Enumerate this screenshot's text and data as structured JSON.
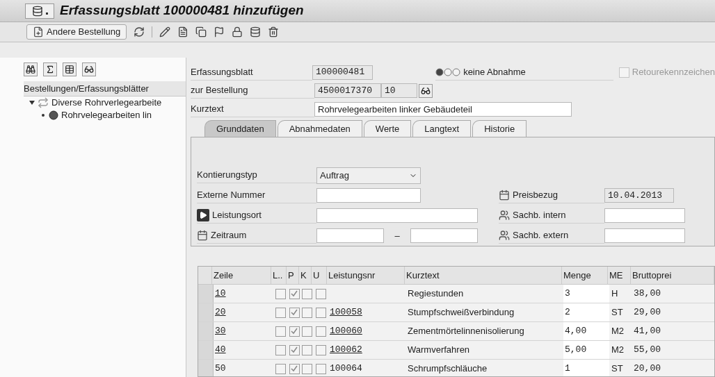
{
  "window": {
    "title": "Erfassungsblatt 100000481 hinzufügen"
  },
  "toolbar": {
    "button": "Andere Bestellung"
  },
  "sidebar": {
    "header": "Bestellungen/Erfassungsblätter",
    "tree": [
      {
        "label": "Diverse Rohrverlegearbeite",
        "expanded": true,
        "children": [
          {
            "label": "Rohrvelegearbeiten lin"
          }
        ]
      }
    ]
  },
  "header": {
    "erfassungsblatt": {
      "label": "Erfassungsblatt",
      "value": "100000481"
    },
    "bestellung": {
      "label": "zur Bestellung",
      "value": "4500017370",
      "item": "10"
    },
    "kurztext": {
      "label": "Kurztext",
      "value": "Rohrvelegearbeiten linker Gebäudeteil"
    },
    "status": {
      "lights": [
        true,
        false,
        false
      ],
      "label": "keine Abnahme"
    },
    "retoure": {
      "label": "Retourekennzeichen",
      "checked": false,
      "disabled": true
    }
  },
  "tabs": [
    {
      "label": "Grunddaten",
      "selected": true
    },
    {
      "label": "Abnahmedaten",
      "selected": false
    },
    {
      "label": "Werte",
      "selected": false
    },
    {
      "label": "Langtext",
      "selected": false
    },
    {
      "label": "Historie",
      "selected": false
    }
  ],
  "form": {
    "kontierungstyp": {
      "label": "Kontierungstyp",
      "value": "Auftrag"
    },
    "externe_nummer": {
      "label": "Externe Nummer"
    },
    "leistungsort": {
      "label": "Leistungsort"
    },
    "zeitraum": {
      "label": "Zeitraum",
      "separator": "–"
    },
    "preisbezug": {
      "label": "Preisbezug",
      "value": "10.04.2013"
    },
    "sachb_intern": {
      "label": "Sachb. intern"
    },
    "sachb_extern": {
      "label": "Sachb. extern"
    }
  },
  "table": {
    "columns": [
      "Zeile",
      "L..",
      "P",
      "K",
      "U",
      "Leistungsnr",
      "Kurztext",
      "Menge",
      "ME",
      "Bruttoprei"
    ],
    "rows": [
      {
        "zeile": "10",
        "linked": true,
        "checks": [
          false,
          true,
          false,
          false
        ],
        "leistungsnr": "",
        "kurztext": "Regiestunden",
        "menge": "3",
        "me": "H",
        "brutto": "38,00"
      },
      {
        "zeile": "20",
        "linked": true,
        "checks": [
          false,
          true,
          false,
          false
        ],
        "leistungsnr": "100058",
        "kurztext": "Stumpfschweißverbindung",
        "menge": "2",
        "me": "ST",
        "brutto": "29,00"
      },
      {
        "zeile": "30",
        "linked": true,
        "checks": [
          false,
          true,
          false,
          false
        ],
        "leistungsnr": "100060",
        "kurztext": "Zementmörtelinnenisolierung",
        "menge": "4,00",
        "me": "M2",
        "brutto": "41,00"
      },
      {
        "zeile": "40",
        "linked": true,
        "checks": [
          false,
          true,
          false,
          false
        ],
        "leistungsnr": "100062",
        "kurztext": "Warmverfahren",
        "menge": "5,00",
        "me": "M2",
        "brutto": "55,00"
      },
      {
        "zeile": "50",
        "linked": false,
        "checks": [
          false,
          true,
          false,
          false
        ],
        "leistungsnr": "100064",
        "kurztext": "Schrumpfschläuche",
        "menge": "1",
        "me": "ST",
        "brutto": "20,00"
      }
    ]
  }
}
